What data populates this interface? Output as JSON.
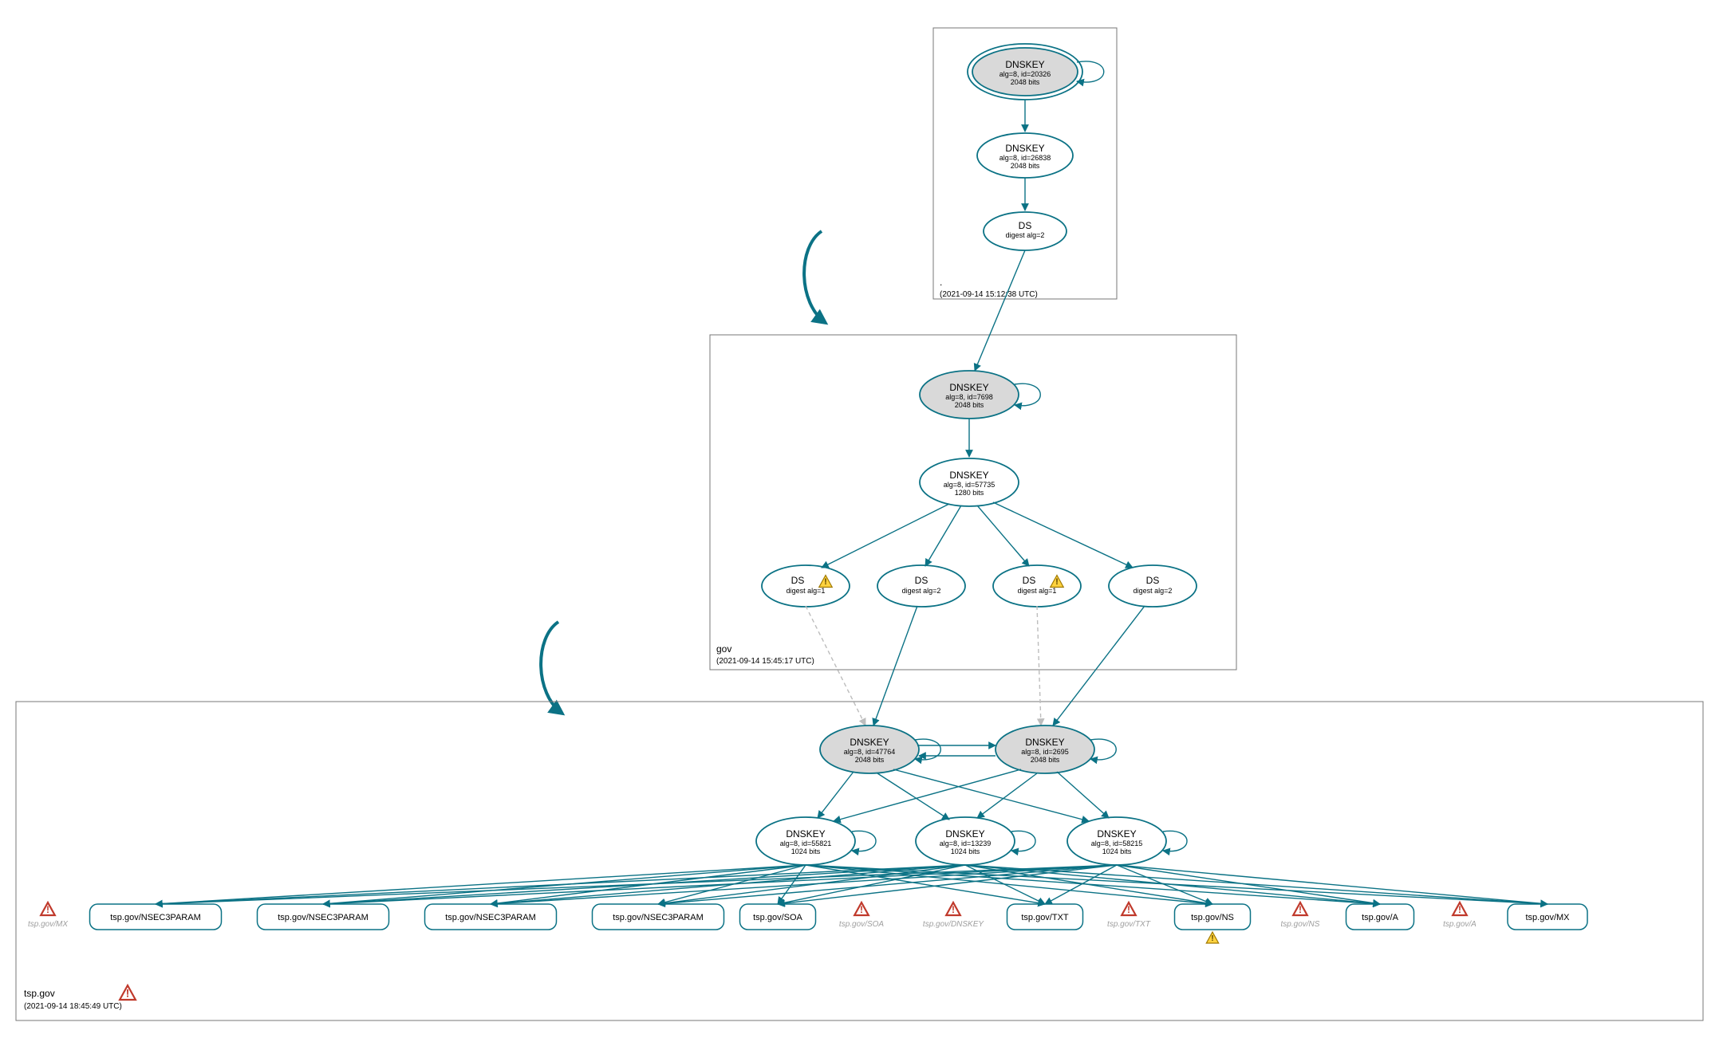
{
  "colors": {
    "teal": "#0b7285",
    "ksk_fill": "#d9d9d9",
    "ghost": "#9e9e9e",
    "warn_yellow": "#ffd23f",
    "error_red": "#c0392b"
  },
  "zones": {
    "root": {
      "label": ".",
      "timestamp": "(2021-09-14 15:12:38 UTC)"
    },
    "gov": {
      "label": "gov",
      "timestamp": "(2021-09-14 15:45:17 UTC)"
    },
    "tsp": {
      "label": "tsp.gov",
      "timestamp": "(2021-09-14 18:45:49 UTC)",
      "has_error_badge": true
    }
  },
  "root_nodes": {
    "ksk": {
      "title": "DNSKEY",
      "line1": "alg=8, id=20326",
      "line2": "2048 bits"
    },
    "zsk": {
      "title": "DNSKEY",
      "line1": "alg=8, id=26838",
      "line2": "2048 bits"
    },
    "ds": {
      "title": "DS",
      "line1": "digest alg=2"
    }
  },
  "gov_nodes": {
    "ksk": {
      "title": "DNSKEY",
      "line1": "alg=8, id=7698",
      "line2": "2048 bits"
    },
    "zsk": {
      "title": "DNSKEY",
      "line1": "alg=8, id=57735",
      "line2": "1280 bits"
    },
    "ds1": {
      "title": "DS",
      "line1": "digest alg=1",
      "warn": true
    },
    "ds2": {
      "title": "DS",
      "line1": "digest alg=2"
    },
    "ds3": {
      "title": "DS",
      "line1": "digest alg=1",
      "warn": true
    },
    "ds4": {
      "title": "DS",
      "line1": "digest alg=2"
    }
  },
  "tsp_nodes": {
    "ksk1": {
      "title": "DNSKEY",
      "line1": "alg=8, id=47764",
      "line2": "2048 bits"
    },
    "ksk2": {
      "title": "DNSKEY",
      "line1": "alg=8, id=2695",
      "line2": "2048 bits"
    },
    "zsk1": {
      "title": "DNSKEY",
      "line1": "alg=8, id=55821",
      "line2": "1024 bits"
    },
    "zsk2": {
      "title": "DNSKEY",
      "line1": "alg=8, id=13239",
      "line2": "1024 bits"
    },
    "zsk3": {
      "title": "DNSKEY",
      "line1": "alg=8, id=58215",
      "line2": "1024 bits"
    }
  },
  "rrsets": [
    {
      "kind": "ghost",
      "label": "tsp.gov/MX"
    },
    {
      "kind": "box",
      "label": "tsp.gov/NSEC3PARAM"
    },
    {
      "kind": "box",
      "label": "tsp.gov/NSEC3PARAM"
    },
    {
      "kind": "box",
      "label": "tsp.gov/NSEC3PARAM"
    },
    {
      "kind": "box",
      "label": "tsp.gov/NSEC3PARAM"
    },
    {
      "kind": "box",
      "label": "tsp.gov/SOA"
    },
    {
      "kind": "ghost",
      "label": "tsp.gov/SOA"
    },
    {
      "kind": "ghost",
      "label": "tsp.gov/DNSKEY"
    },
    {
      "kind": "box",
      "label": "tsp.gov/TXT"
    },
    {
      "kind": "ghost",
      "label": "tsp.gov/TXT"
    },
    {
      "kind": "box",
      "label": "tsp.gov/NS",
      "warn": true
    },
    {
      "kind": "ghost",
      "label": "tsp.gov/NS"
    },
    {
      "kind": "box",
      "label": "tsp.gov/A"
    },
    {
      "kind": "ghost",
      "label": "tsp.gov/A"
    },
    {
      "kind": "box",
      "label": "tsp.gov/MX"
    }
  ]
}
